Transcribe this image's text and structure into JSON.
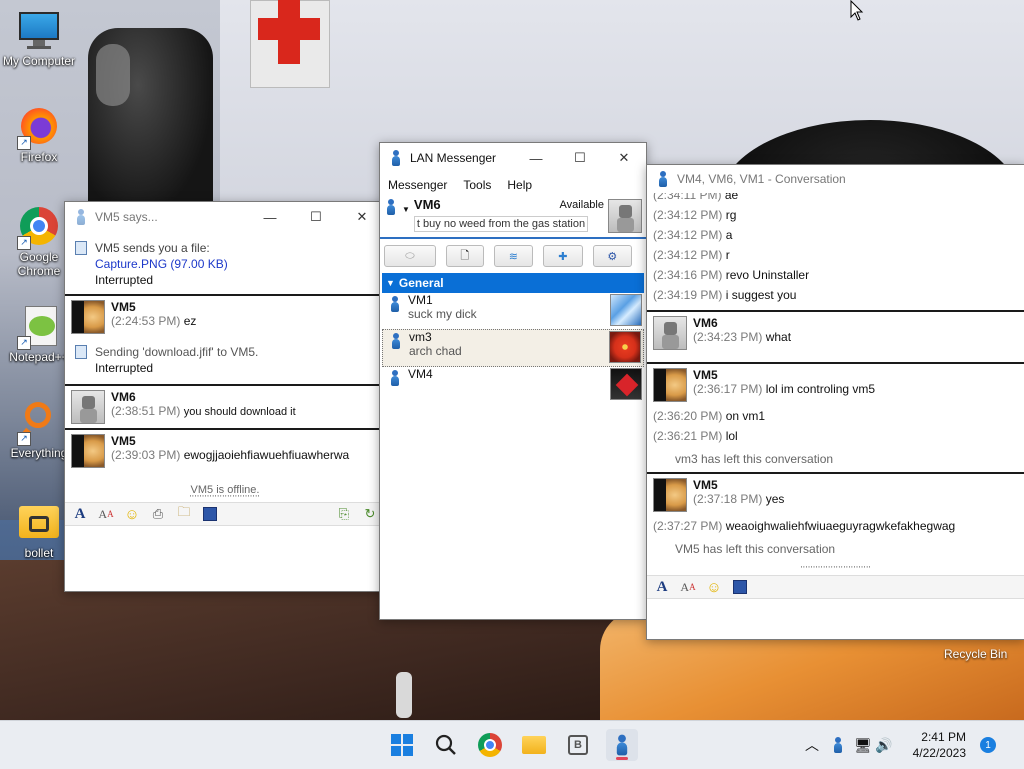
{
  "desktop": {
    "icons": [
      {
        "label": "My Computer"
      },
      {
        "label": "Firefox"
      },
      {
        "label": "Google Chrome"
      },
      {
        "label": "Notepad++"
      },
      {
        "label": "Everything"
      },
      {
        "label": "bollet"
      }
    ],
    "recycle_bin": "Recycle Bin"
  },
  "vm5_window": {
    "title": "VM5 says...",
    "file_msg": {
      "line1": "VM5 sends you a file:",
      "file": "Capture.PNG (97.00 KB)",
      "status": "Interrupted"
    },
    "messages": [
      {
        "sender": "VM5",
        "time": "(2:24:53 PM)",
        "text": "ez"
      },
      {
        "sender": "VM6",
        "time": "(2:38:51 PM)",
        "text": "you should download it"
      },
      {
        "sender": "VM5",
        "time": "(2:39:03 PM)",
        "text": "ewogjjaoiehfiawuehfiuawherwa"
      }
    ],
    "send_msg": {
      "line1": "Sending 'download.jfif' to VM5.",
      "status": "Interrupted"
    },
    "offline": "VM5 is offline."
  },
  "lan_messenger": {
    "title": "LAN Messenger",
    "menu": [
      "Messenger",
      "Tools",
      "Help"
    ],
    "user": {
      "name": "VM6",
      "status": "Available",
      "note": "t buy no weed from the gas station"
    },
    "group": "General",
    "contacts": [
      {
        "name": "VM1",
        "note": "suck my dick"
      },
      {
        "name": "vm3",
        "note": "arch chad"
      },
      {
        "name": "VM4",
        "note": ""
      }
    ]
  },
  "conversation": {
    "title": "VM4, VM6, VM1 - Conversation",
    "top_lines": [
      {
        "time": "(2:34:11 PM)",
        "text": "ae"
      },
      {
        "time": "(2:34:12 PM)",
        "text": "rg"
      },
      {
        "time": "(2:34:12 PM)",
        "text": "a"
      },
      {
        "time": "(2:34:12 PM)",
        "text": "r"
      },
      {
        "time": "(2:34:16 PM)",
        "text": "revo Uninstaller"
      },
      {
        "time": "(2:34:19 PM)",
        "text": "i suggest you"
      }
    ],
    "vm6_block": {
      "sender": "VM6",
      "time": "(2:34:23 PM)",
      "text": "what"
    },
    "vm5_block1": {
      "sender": "VM5",
      "time": "(2:36:17 PM)",
      "text": "lol im controling vm5"
    },
    "vm5_block1_extra": [
      {
        "time": "(2:36:20 PM)",
        "text": "on vm1"
      },
      {
        "time": "(2:36:21 PM)",
        "text": "lol"
      }
    ],
    "left1": "vm3 has left this conversation",
    "vm5_block2": {
      "sender": "VM5",
      "time": "(2:37:18 PM)",
      "text": "yes"
    },
    "vm5_block2_extra": [
      {
        "time": "(2:37:27 PM)",
        "text": "weaoighwaliehfwiuaeguyragwkefakhegwag"
      }
    ],
    "left2": "VM5 has left this conversation"
  },
  "taskbar": {
    "time": "2:41 PM",
    "date": "4/22/2023",
    "notifications": "1"
  }
}
